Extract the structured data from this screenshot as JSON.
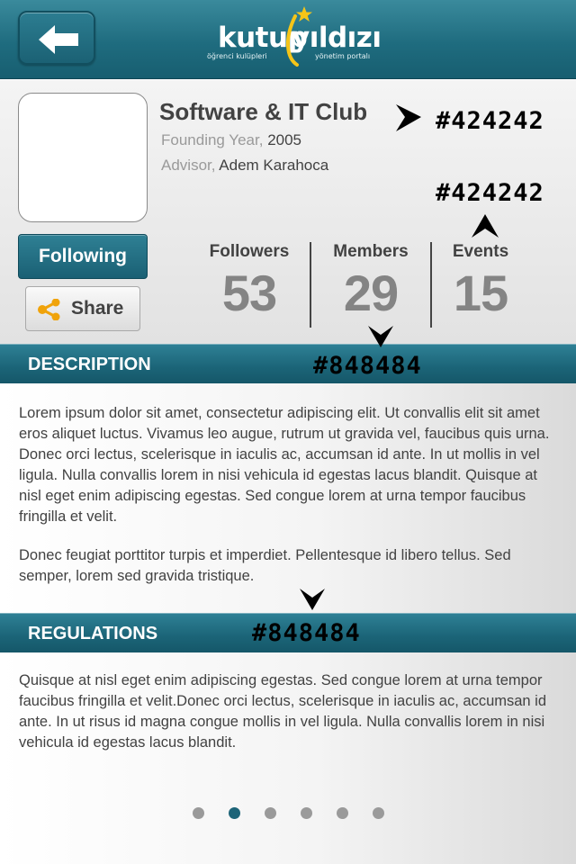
{
  "header": {
    "logo_word_1": "kutup",
    "logo_word_2": "yıldızı",
    "logo_sub_1": "öğrenci kulüpleri",
    "logo_sub_2": "yönetim portalı"
  },
  "club": {
    "name": "Software & IT Club",
    "founding_label": "Founding Year,",
    "founding_value": "2005",
    "advisor_label": "Advisor,",
    "advisor_value": "Adem Karahoca"
  },
  "actions": {
    "following_label": "Following",
    "share_label": "Share"
  },
  "stats": {
    "followers_label": "Followers",
    "followers_value": "53",
    "members_label": "Members",
    "members_value": "29",
    "events_label": "Events",
    "events_value": "15"
  },
  "description": {
    "title": "DESCRIPTION",
    "paragraph_1": "Lorem ipsum dolor sit amet, consectetur adipiscing elit. Ut convallis elit sit amet eros aliquet luctus. Vivamus leo augue, rutrum ut gravida vel, faucibus quis urna. Donec orci lectus, scelerisque in iaculis ac, accumsan id ante. In ut mollis in vel ligula. Nulla convallis lorem in nisi vehicula id egestas lacus blandit. Quisque at nisl eget enim adipiscing egestas. Sed congue lorem at urna tempor faucibus fringilla et velit.",
    "paragraph_2": "Donec feugiat porttitor turpis et imperdiet. Pellentesque id libero tellus. Sed semper, lorem sed gravida tristique."
  },
  "regulations": {
    "title": "REGULATIONS",
    "paragraph_1": "Quisque at nisl eget enim adipiscing egestas. Sed congue lorem at urna tempor faucibus fringilla et velit.Donec orci lectus, scelerisque in iaculis ac, accumsan id ante. In ut risus id magna congue mollis in vel ligula. Nulla convallis lorem in nisi vehicula id egestas lacus blandit."
  },
  "annotations": {
    "name_color": "#424242",
    "stats_color": "#424242",
    "stat_number_color": "#848484",
    "regulations_color": "#848484"
  },
  "pagination": {
    "total_pages": 6,
    "active_page": 2
  },
  "colors": {
    "accent": "#1d6478",
    "text_dark": "#424242",
    "text_gray": "#848484"
  }
}
